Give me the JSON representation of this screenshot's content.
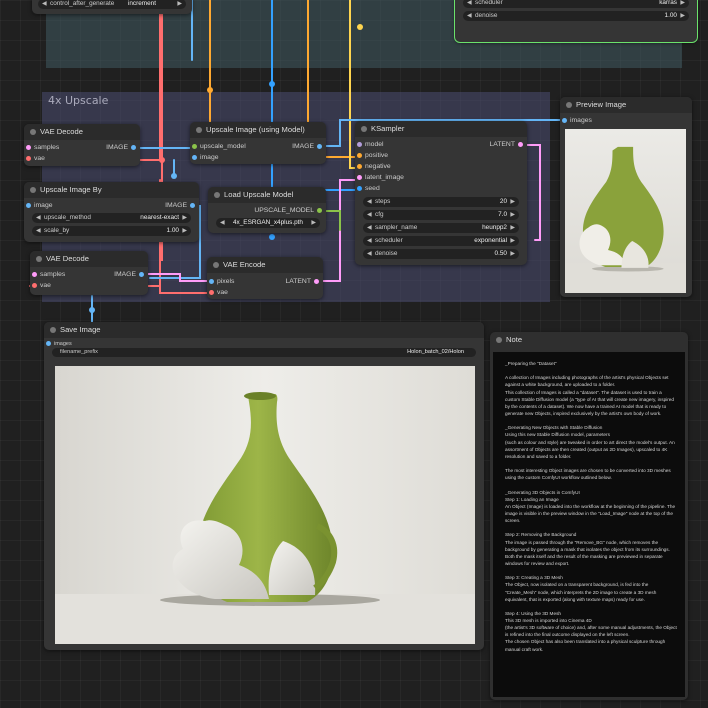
{
  "groups": {
    "upscale": {
      "title": "4x Upscale"
    }
  },
  "top_fragments": {
    "control_after_generate": {
      "label": "control_after_generate",
      "value": "increment"
    },
    "scheduler": {
      "label": "scheduler",
      "value": "karras"
    },
    "denoise": {
      "label": "denoise",
      "value": "1.00"
    }
  },
  "nodes": {
    "vae_decode_1": {
      "title": "VAE Decode",
      "inputs": [
        "samples",
        "vae"
      ],
      "output": "IMAGE"
    },
    "upscale_with_model": {
      "title": "Upscale Image (using Model)",
      "inputs": [
        "upscale_model",
        "image"
      ],
      "output": "IMAGE"
    },
    "ksampler": {
      "title": "KSampler",
      "inputs": [
        "model",
        "positive",
        "negative",
        "latent_image",
        "seed"
      ],
      "output": "LATENT",
      "widgets": [
        {
          "label": "steps",
          "value": "20"
        },
        {
          "label": "cfg",
          "value": "7.0"
        },
        {
          "label": "sampler_name",
          "value": "heunpp2"
        },
        {
          "label": "scheduler",
          "value": "exponential"
        },
        {
          "label": "denoise",
          "value": "0.50"
        }
      ]
    },
    "preview_image": {
      "title": "Preview Image",
      "input": "images"
    },
    "upscale_image_by": {
      "title": "Upscale Image By",
      "input": "image",
      "output": "IMAGE",
      "widgets": [
        {
          "label": "upscale_method",
          "value": "nearest-exact"
        },
        {
          "label": "scale_by",
          "value": "1.00"
        }
      ]
    },
    "load_upscale_model": {
      "title": "Load Upscale Model",
      "output": "UPSCALE_MODEL",
      "model_name": "4x_ESRGAN_x4plus.pth"
    },
    "vae_decode_2": {
      "title": "VAE Decode",
      "inputs": [
        "samples",
        "vae"
      ],
      "output": "IMAGE"
    },
    "vae_encode": {
      "title": "VAE Encode",
      "inputs": [
        "pixels",
        "vae"
      ],
      "output": "LATENT"
    },
    "save_image": {
      "title": "Save Image",
      "input": "images",
      "widget": {
        "label": "filename_prefix",
        "value": "Holon_batch_02/Holon"
      }
    },
    "note": {
      "title": "Note",
      "text": "_Preparing the \"Dataset\"\n\nA collection of Images including photographs of the artist's physical Objects set against a white background, are uploaded to a folder.\nThis collection of Images is called a \"dataset\". The dataset is used to train a custom Stable Diffusion model (a \"type of AI that will create new imagery, inspired by the contents of a dataset). We now have a trained AI model that is ready to generate new Objects, inspired exclusively by the artist's own body of work.\n\n_Generating New Objects with Stable Diffusion\nUsing this new Stable Diffusion model, parameters\n(such as colour and style) are tweaked in order to art direct the model's output. An assortment of Objects are then created (output as 2D Images), upscaled to 4K resolution and saved to a folder.\n\nThe most interesting Object images are chosen to be converted into 3D meshes using the custom ComfyUI workflow outlined below.\n\n_Generating 3D Objects in ComfyUI\nStep 1: Loading an Image\nAn Object (Image) is loaded into the workflow at the beginning of the pipeline. The image is visible in the preview window in the \"Load_Image\" node at the top of the screen.\n\nStep 2: Removing the Background\nThe image is passed through the \"Remove_BG\" node, which removes the background by generating a mask that isolates the object from its surroundings. Both the mask itself and the result of the masking are previewed in separate windows for review and export.\n\nStep 3: Creating a 3D Mesh\nThe Object, now isolated on a transparent background, is fed into the \"Create_Mesh\" node, which interprets the 2D image to create a 3D mesh equivalent, that is exported (along with texture maps) ready for use.\n\nStep 4: Using the 3D Mesh\nThis 3D mesh is imported into Cinema 4D\n(the artist's 3D software of choice) and, after some manual adjustments, the Object is refined into the final outcome displayed on the left screen.\nThe chosen Object has also been translated into a physical sculpture through manual craft work."
    }
  },
  "colors": {
    "image_pin": "#64b5f6",
    "latent_pin": "#ff9cf9",
    "model_pin": "#b39ddb",
    "conditioning_pin": "#ffa931",
    "vae_pin": "#ff6e6e",
    "int_pin": "#33a1ff",
    "upscale_model_pin": "#8bc34a",
    "group_fill": "#3f5a61",
    "group_fill_purple": "#484a6a",
    "selected_outline": "#6be26b"
  }
}
